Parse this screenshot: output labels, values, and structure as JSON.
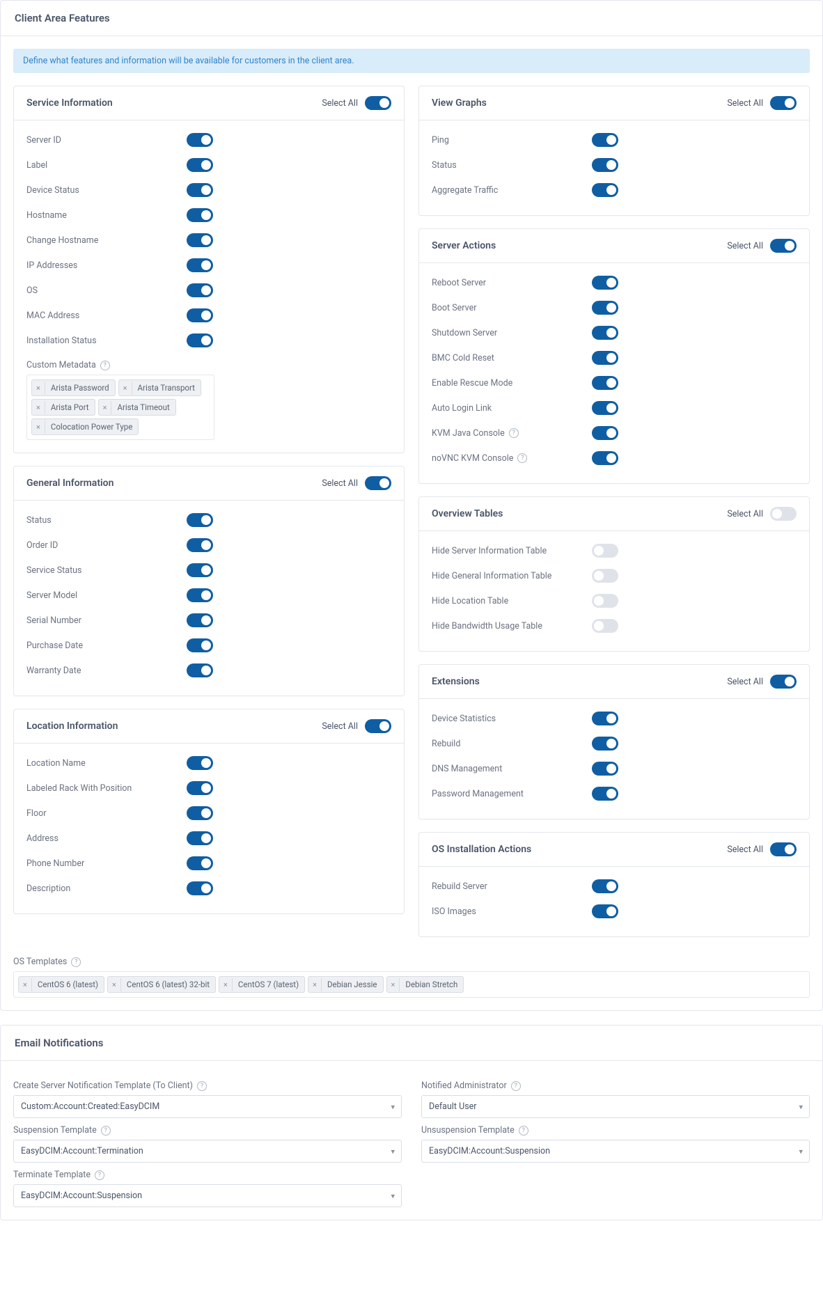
{
  "page_title": "Client Area Features",
  "banner": "Define what features and information will be available for customers in the client area.",
  "select_all_text": "Select All",
  "sections": {
    "service_info": {
      "title": "Service Information",
      "select_all_on": true,
      "items": [
        {
          "label": "Server ID",
          "on": true
        },
        {
          "label": "Label",
          "on": true
        },
        {
          "label": "Device Status",
          "on": true
        },
        {
          "label": "Hostname",
          "on": true
        },
        {
          "label": "Change Hostname",
          "on": true
        },
        {
          "label": "IP Addresses",
          "on": true
        },
        {
          "label": "OS",
          "on": true
        },
        {
          "label": "MAC Address",
          "on": true
        },
        {
          "label": "Installation Status",
          "on": true
        }
      ],
      "custom_metadata_label": "Custom Metadata",
      "custom_metadata_tags": [
        "Arista Password",
        "Arista Transport",
        "Arista Port",
        "Arista Timeout",
        "Colocation Power Type"
      ]
    },
    "general_info": {
      "title": "General Information",
      "select_all_on": true,
      "items": [
        {
          "label": "Status",
          "on": true
        },
        {
          "label": "Order ID",
          "on": true
        },
        {
          "label": "Service Status",
          "on": true
        },
        {
          "label": "Server Model",
          "on": true
        },
        {
          "label": "Serial Number",
          "on": true
        },
        {
          "label": "Purchase Date",
          "on": true
        },
        {
          "label": "Warranty Date",
          "on": true
        }
      ]
    },
    "location_info": {
      "title": "Location Information",
      "select_all_on": true,
      "items": [
        {
          "label": "Location Name",
          "on": true
        },
        {
          "label": "Labeled Rack With Position",
          "on": true
        },
        {
          "label": "Floor",
          "on": true
        },
        {
          "label": "Address",
          "on": true
        },
        {
          "label": "Phone Number",
          "on": true
        },
        {
          "label": "Description",
          "on": true
        }
      ]
    },
    "view_graphs": {
      "title": "View Graphs",
      "select_all_on": true,
      "items": [
        {
          "label": "Ping",
          "on": true
        },
        {
          "label": "Status",
          "on": true
        },
        {
          "label": "Aggregate Traffic",
          "on": true
        }
      ]
    },
    "server_actions": {
      "title": "Server Actions",
      "select_all_on": true,
      "items": [
        {
          "label": "Reboot Server",
          "on": true
        },
        {
          "label": "Boot Server",
          "on": true
        },
        {
          "label": "Shutdown Server",
          "on": true
        },
        {
          "label": "BMC Cold Reset",
          "on": true
        },
        {
          "label": "Enable Rescue Mode",
          "on": true
        },
        {
          "label": "Auto Login Link",
          "on": true
        },
        {
          "label": "KVM Java Console",
          "on": true,
          "help": true
        },
        {
          "label": "noVNC KVM Console",
          "on": true,
          "help": true
        }
      ]
    },
    "overview_tables": {
      "title": "Overview Tables",
      "select_all_on": false,
      "items": [
        {
          "label": "Hide Server Information Table",
          "on": false
        },
        {
          "label": "Hide General Information Table",
          "on": false
        },
        {
          "label": "Hide Location Table",
          "on": false
        },
        {
          "label": "Hide Bandwidth Usage Table",
          "on": false
        }
      ]
    },
    "extensions": {
      "title": "Extensions",
      "select_all_on": true,
      "items": [
        {
          "label": "Device Statistics",
          "on": true
        },
        {
          "label": "Rebuild",
          "on": true
        },
        {
          "label": "DNS Management",
          "on": true
        },
        {
          "label": "Password Management",
          "on": true
        }
      ]
    },
    "os_install": {
      "title": "OS Installation Actions",
      "select_all_on": true,
      "items": [
        {
          "label": "Rebuild Server",
          "on": true
        },
        {
          "label": "ISO Images",
          "on": true
        }
      ]
    }
  },
  "os_templates_label": "OS Templates",
  "os_templates": [
    "CentOS 6 (latest)",
    "CentOS 6 (latest) 32-bit",
    "CentOS 7 (latest)",
    "Debian Jessie",
    "Debian Stretch"
  ],
  "email": {
    "title": "Email Notifications",
    "fields": {
      "create_server": {
        "label": "Create Server Notification Template (To Client)",
        "value": "Custom:Account:Created:EasyDCIM"
      },
      "notified_admin": {
        "label": "Notified Administrator",
        "value": "Default User"
      },
      "suspension": {
        "label": "Suspension Template",
        "value": "EasyDCIM:Account:Termination"
      },
      "unsuspension": {
        "label": "Unsuspension Template",
        "value": "EasyDCIM:Account:Suspension"
      },
      "terminate": {
        "label": "Terminate Template",
        "value": "EasyDCIM:Account:Suspension"
      }
    }
  }
}
